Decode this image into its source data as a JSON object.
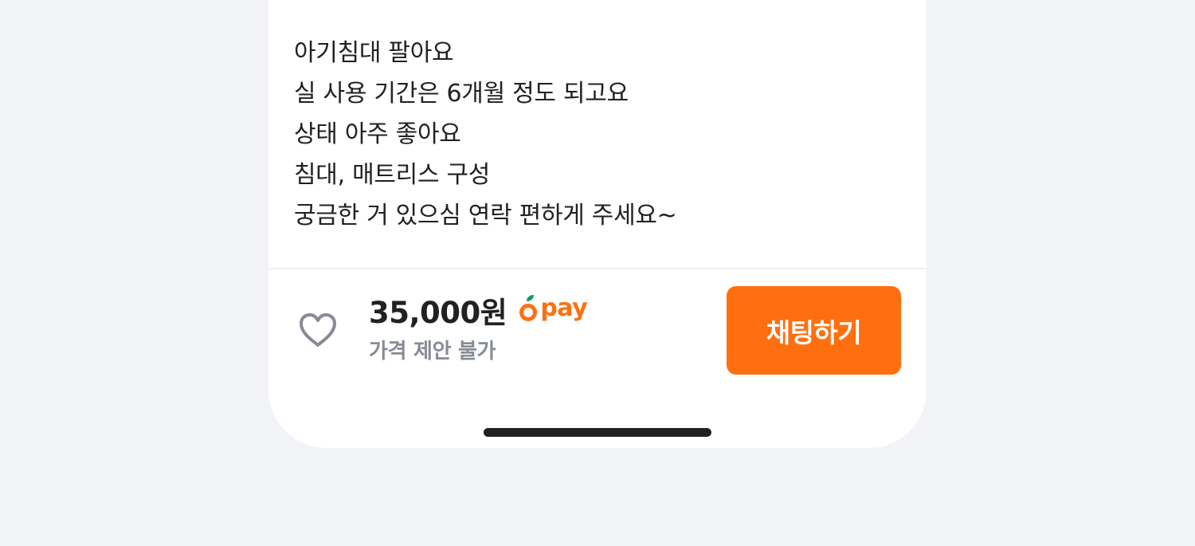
{
  "description": {
    "lines": [
      "아기침대 팔아요",
      "실 사용 기간은 6개월 정도 되고요",
      "상태 아주 좋아요",
      "침대, 매트리스 구성",
      "궁금한 거 있으심 연락 편하게 주세요~"
    ]
  },
  "bottom_bar": {
    "like_icon": "heart-outline-icon",
    "price": "35,000원",
    "pay_label": "pay",
    "pay_icon": "carrot-icon",
    "price_note": "가격 제안 불가",
    "chat_button_label": "채팅하기"
  },
  "colors": {
    "accent": "#ff6f0f",
    "text_primary": "#212124",
    "text_secondary": "#868b94",
    "background": "#f2f3f6"
  }
}
